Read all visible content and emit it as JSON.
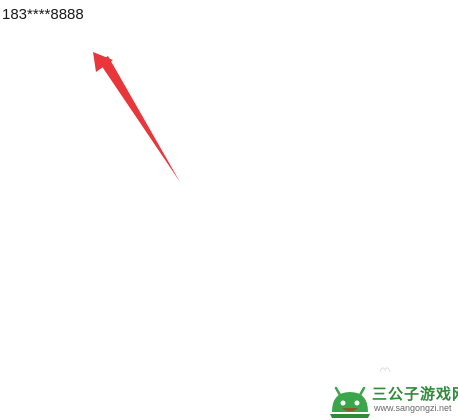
{
  "content": {
    "phone_number": "183****8888"
  },
  "annotation": {
    "arrow_color": "#e8363a"
  },
  "watermark": {
    "title": "三公子游戏网",
    "url": "www.sangongzi.net",
    "brand_color": "#2e8b3a",
    "logo_color": "#3aa64a"
  }
}
